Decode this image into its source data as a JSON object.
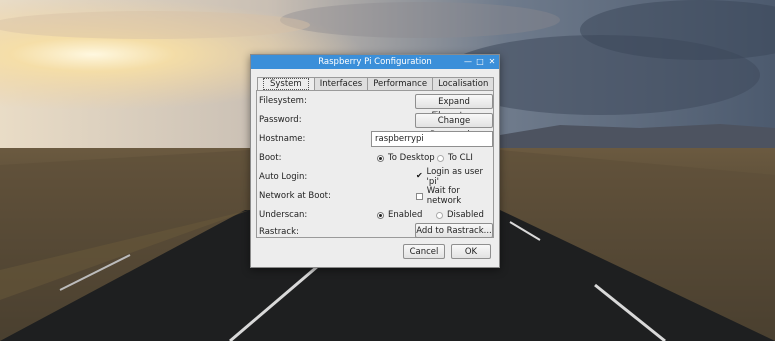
{
  "dialog": {
    "title": "Raspberry Pi Configuration",
    "window_controls": [
      "—",
      "□",
      "✕"
    ]
  },
  "tabs": [
    "System",
    "Interfaces",
    "Performance",
    "Localisation"
  ],
  "active_tab": "System",
  "rows": {
    "filesystem": {
      "label": "Filesystem:",
      "button": "Expand Filesystem"
    },
    "password": {
      "label": "Password:",
      "button": "Change Password..."
    },
    "hostname": {
      "label": "Hostname:",
      "value": "raspberrypi"
    },
    "boot": {
      "label": "Boot:",
      "option1": "To Desktop",
      "option2": "To CLI",
      "selected": "To Desktop"
    },
    "autologin": {
      "label": "Auto Login:",
      "checkbox": "Login as user 'pi'",
      "checked": true
    },
    "networkboot": {
      "label": "Network at Boot:",
      "checkbox": "Wait for network",
      "checked": false
    },
    "underscan": {
      "label": "Underscan:",
      "option1": "Enabled",
      "option2": "Disabled",
      "selected": "Enabled"
    },
    "rastrack": {
      "label": "Rastrack:",
      "button": "Add to Rastrack..."
    }
  },
  "footer": {
    "cancel": "Cancel",
    "ok": "OK"
  },
  "colors": {
    "titlebar": "#3b8fd9",
    "dialog_bg": "#ededed"
  }
}
